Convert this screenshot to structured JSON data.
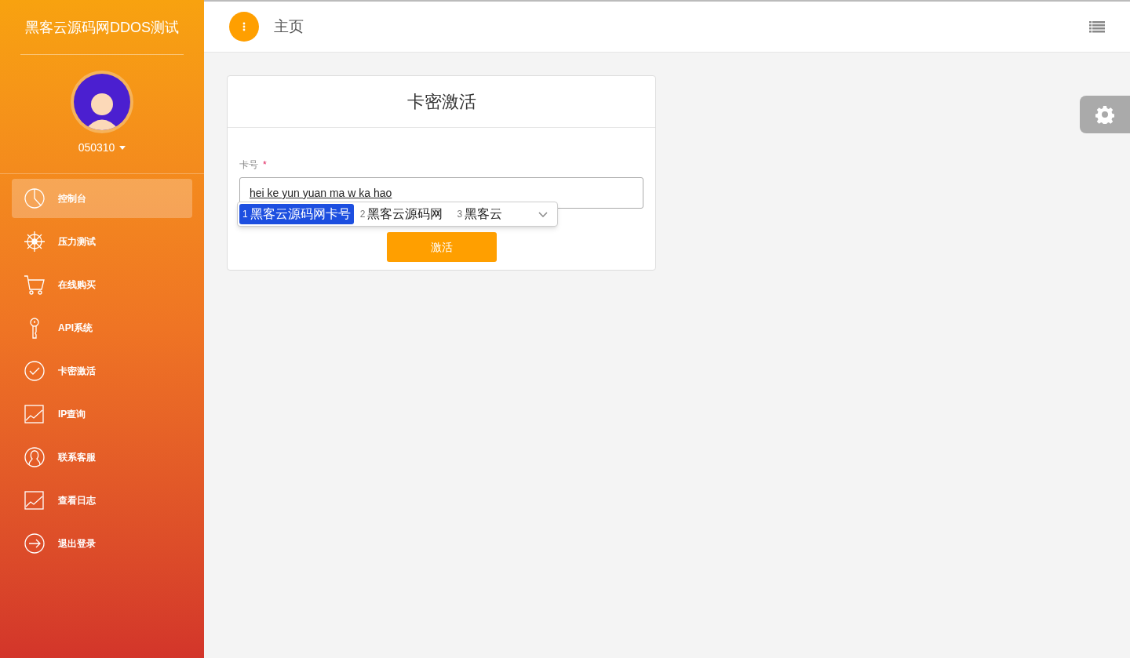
{
  "sidebar": {
    "brand": "黑客云源码网DDOS测试",
    "user": "050310",
    "items": [
      {
        "label": "控制台",
        "selected": true
      },
      {
        "label": "压力测试",
        "selected": false
      },
      {
        "label": "在线购买",
        "selected": false
      },
      {
        "label": "API系统",
        "selected": false
      },
      {
        "label": "卡密激活",
        "selected": false
      },
      {
        "label": "IP查询",
        "selected": false
      },
      {
        "label": "联系客服",
        "selected": false
      },
      {
        "label": "查看日志",
        "selected": false
      },
      {
        "label": "退出登录",
        "selected": false
      }
    ]
  },
  "header": {
    "title": "主页"
  },
  "card": {
    "title": "卡密激活",
    "field": {
      "label": "卡号",
      "required_mark": "*",
      "value": "hei ke yun yuan ma w ka hao"
    },
    "button": "激活"
  },
  "ime": {
    "candidates": [
      {
        "number": "1",
        "text": "黑客云源码网卡号",
        "selected": true
      },
      {
        "number": "2",
        "text": "黑客云源码网",
        "selected": false
      },
      {
        "number": "3",
        "text": "黑客云",
        "selected": false
      }
    ]
  }
}
